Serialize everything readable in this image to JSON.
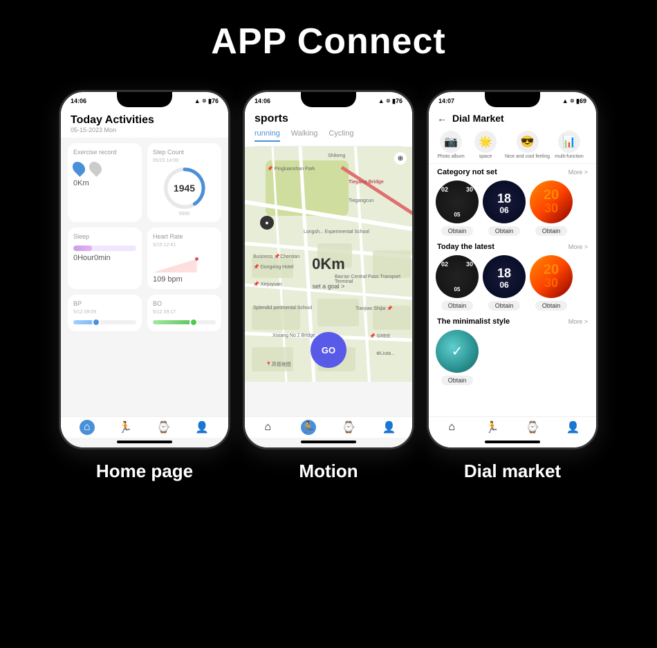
{
  "page": {
    "title": "APP Connect",
    "background": "#000000"
  },
  "phones": [
    {
      "id": "home-page",
      "label": "Home page",
      "status_time": "14:06",
      "header": {
        "title": "Today Activities",
        "date": "05-15-2023 Mon"
      },
      "cards": {
        "exercise": {
          "title": "Exercise record",
          "value": "0Km"
        },
        "step_count": {
          "title": "Step Count",
          "sub": "05/15 14:09",
          "value": "1945",
          "goal": "5000"
        },
        "sleep": {
          "title": "Sleep",
          "value": "0Hour0min"
        },
        "heart_rate": {
          "title": "Heart Rate",
          "sub": "5/15 12:41",
          "value": "109 bpm"
        },
        "bp": {
          "title": "BP",
          "sub": "5/12 09:09"
        },
        "bo": {
          "title": "BO",
          "sub": "5/12 09:17"
        }
      }
    },
    {
      "id": "motion",
      "label": "Motion",
      "status_time": "14:06",
      "header": {
        "title": "sports",
        "tabs": [
          "running",
          "Walking",
          "Cycling"
        ]
      },
      "map": {
        "distance": "0Km",
        "goal_text": "set a goal >",
        "go_button": "GO",
        "labels": [
          "Shikeng",
          "Pingluanshan Park",
          "Tiegang Bridge",
          "Tiegangcun",
          "Longsh... Experimental School",
          "Business Chentian",
          "Dongxing Hotel",
          "Xinjuyuan",
          "Bao'an Central Pass Transport Terminal",
          "Splendid perimental School",
          "Tianjiao Shijia",
          "Xixiang No.1 Bridge",
          "GREE",
          "Liuta..."
        ]
      }
    },
    {
      "id": "dial-market",
      "label": "Dial market",
      "status_time": "14:07",
      "header": {
        "back": "←",
        "title": "Dial Market"
      },
      "categories": [
        {
          "icon": "📷",
          "label": "Photo album"
        },
        {
          "icon": "🌟",
          "label": "space"
        },
        {
          "icon": "😎",
          "label": "Nice and cool feeling"
        },
        {
          "icon": "📊",
          "label": "multi-function"
        }
      ],
      "sections": [
        {
          "title": "Category not set",
          "more": "More >",
          "watches": [
            {
              "type": "dark",
              "labels": [
                "02",
                "30",
                "05"
              ]
            },
            {
              "type": "blue-dark",
              "labels": [
                "18",
                "06"
              ]
            },
            {
              "type": "orange",
              "labels": [
                "20",
                "30"
              ]
            }
          ]
        },
        {
          "title": "Today the latest",
          "more": "More >",
          "watches": [
            {
              "type": "dark",
              "labels": [
                "02",
                "30",
                "05"
              ]
            },
            {
              "type": "blue-dark",
              "labels": [
                "18",
                "06"
              ]
            },
            {
              "type": "orange",
              "labels": [
                "20",
                "30"
              ]
            }
          ]
        },
        {
          "title": "The minimalist style",
          "more": "More >",
          "watches": [
            {
              "type": "teal"
            }
          ]
        }
      ],
      "obtain_label": "Obtain"
    }
  ]
}
